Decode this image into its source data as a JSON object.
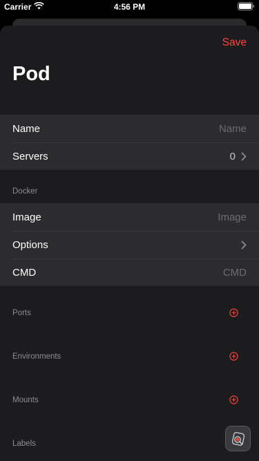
{
  "status_bar": {
    "carrier": "Carrier",
    "time": "4:56 PM",
    "wifi_icon": "wifi-icon",
    "battery_icon": "battery-icon"
  },
  "header": {
    "save_label": "Save",
    "title": "Pod"
  },
  "general": {
    "name_label": "Name",
    "name_placeholder": "Name",
    "name_value": "",
    "servers_label": "Servers",
    "servers_count": "0"
  },
  "docker": {
    "section_title": "Docker",
    "image_label": "Image",
    "image_placeholder": "Image",
    "image_value": "",
    "options_label": "Options",
    "cmd_label": "CMD",
    "cmd_placeholder": "CMD",
    "cmd_value": ""
  },
  "sections": {
    "ports": "Ports",
    "environments": "Environments",
    "mounts": "Mounts",
    "labels": "Labels"
  },
  "colors": {
    "accent": "#ff453a",
    "background": "#1c1c1e",
    "cell": "#2c2c2e"
  }
}
